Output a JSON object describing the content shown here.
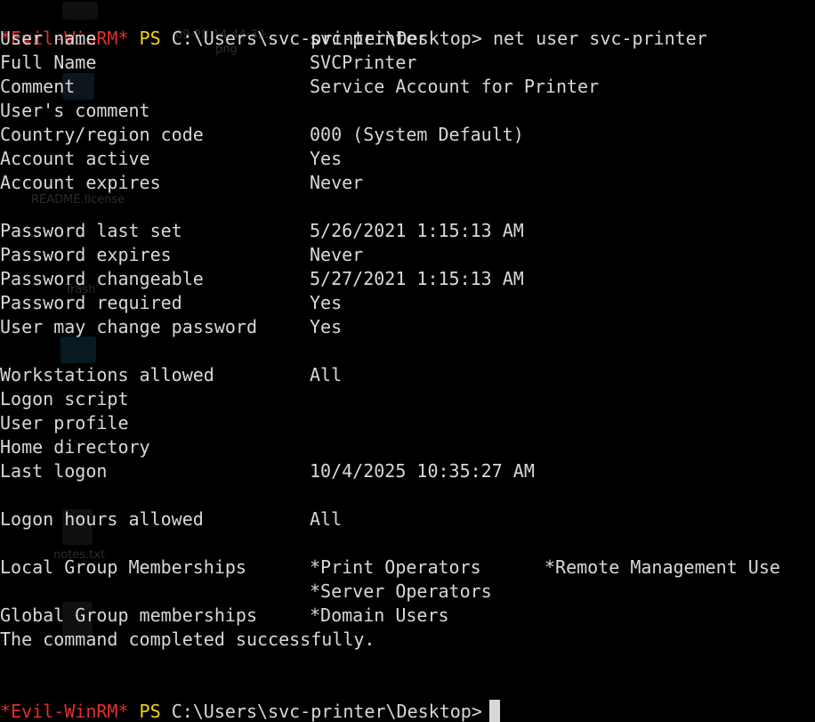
{
  "prompt": {
    "shell": "*Evil-WinRM*",
    "ps": "PS",
    "path": "C:\\Users\\svc-printer\\Desktop>"
  },
  "command": "net user svc-printer",
  "rows": [
    {
      "label": "User name",
      "value": "svc-printer"
    },
    {
      "label": "Full Name",
      "value": "SVCPrinter"
    },
    {
      "label": "Comment",
      "value": "Service Account for Printer"
    },
    {
      "label": "User's comment",
      "value": ""
    },
    {
      "label": "Country/region code",
      "value": "000 (System Default)"
    },
    {
      "label": "Account active",
      "value": "Yes"
    },
    {
      "label": "Account expires",
      "value": "Never"
    },
    {
      "label": "Password last set",
      "value": "5/26/2021 1:15:13 AM"
    },
    {
      "label": "Password expires",
      "value": "Never"
    },
    {
      "label": "Password changeable",
      "value": "5/27/2021 1:15:13 AM"
    },
    {
      "label": "Password required",
      "value": "Yes"
    },
    {
      "label": "User may change password",
      "value": "Yes"
    },
    {
      "label": "Workstations allowed",
      "value": "All"
    },
    {
      "label": "Logon script",
      "value": ""
    },
    {
      "label": "User profile",
      "value": ""
    },
    {
      "label": "Home directory",
      "value": ""
    },
    {
      "label": "Last logon",
      "value": "10/4/2025 10:35:27 AM"
    },
    {
      "label": "Logon hours allowed",
      "value": "All"
    },
    {
      "label": "Local Group Memberships",
      "value": "*Print Operators",
      "value2": "*Remote Management Use"
    },
    {
      "label": "",
      "value": "*Server Operators"
    },
    {
      "label": "Global Group memberships",
      "value": "*Domain Users"
    }
  ],
  "completion": "The command completed successfully.",
  "desktop_ghosts": {
    "screenshot_label_1": "09-28 14-44-33.",
    "screenshot_label_2": "png",
    "readme_label": "README.license",
    "trash_label": "Trash",
    "notes_label": "notes.txt"
  },
  "colors": {
    "background": "#000000",
    "text": "#d8d8d8",
    "shell_name": "#e0302a",
    "ps_keyword": "#f2d21b"
  }
}
